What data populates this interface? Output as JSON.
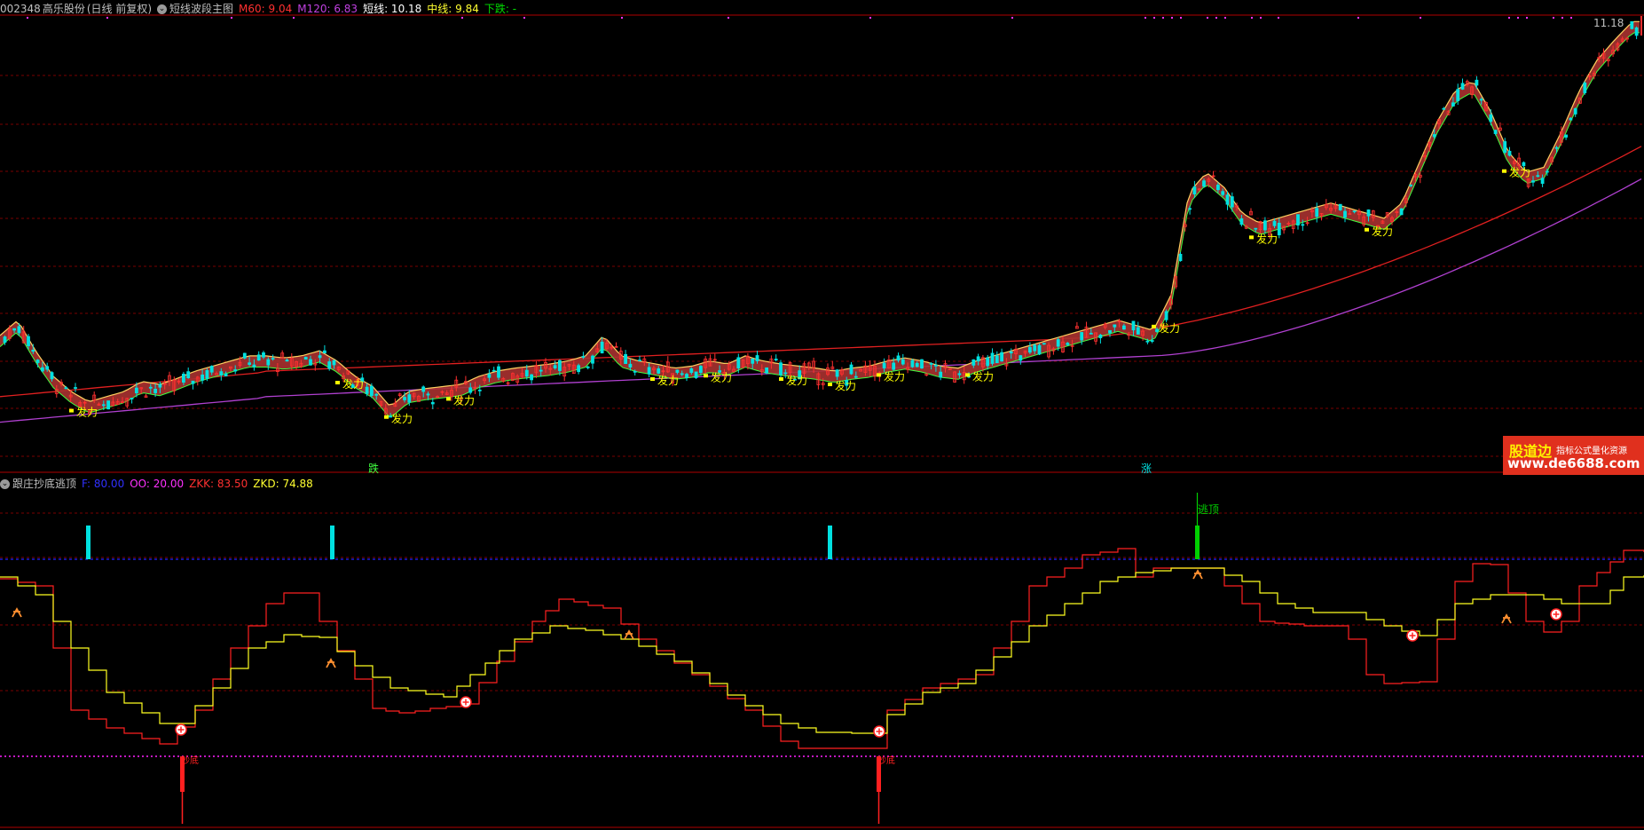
{
  "main_panel": {
    "stock_code": "002348",
    "stock_name": "高乐股份",
    "period": "(日线 前复权)",
    "indicator_name": "短线波段主图",
    "m60_label": "M60: 9.04",
    "m120_label": "M120: 6.83",
    "short_label": "短线: 10.18",
    "mid_label": "中线: 9.84",
    "down_label": "下跌: -",
    "price_max_label": "11.18",
    "signal_label": "发力",
    "bottom_markers": [
      "跌",
      "涨"
    ],
    "colors": {
      "up": "#ff3030",
      "down": "#00e0e0",
      "m60": "#e02020",
      "m120": "#b040d0",
      "band": "#a83230",
      "line_short": "#ffd060",
      "line_mid": "#ffffff",
      "signal": "#ffff00",
      "grid": "#7a0000"
    }
  },
  "sub_panel": {
    "title": "跟庄抄底逃顶",
    "f_label": "F: 80.00",
    "oo_label": "OO: 20.00",
    "zkk_label": "ZKK: 83.50",
    "zkd_label": "ZKD: 74.88",
    "top_escape_label": "逃顶",
    "bottom_label": "抄底",
    "colors": {
      "zkk": "#ff2020",
      "zkd": "#ffff20",
      "f": "#2020ff",
      "oo": "#ff20ff",
      "cyan": "#00e0e0",
      "green": "#00d000"
    }
  },
  "watermark": {
    "brand": "股道边",
    "tagline": "指标公式量化资源",
    "url": "www.de6688.com"
  },
  "chart_data": [
    {
      "type": "candlestick",
      "title": "短线波段主图",
      "series": [
        {
          "name": "M60",
          "values": [
            8.0,
            8.05,
            8.1,
            8.12,
            8.15,
            8.18,
            8.2,
            8.25,
            8.3,
            8.4,
            8.6,
            8.85,
            9.04
          ]
        },
        {
          "name": "M120",
          "values": [
            7.6,
            7.65,
            7.7,
            7.75,
            7.8,
            7.85,
            7.9,
            7.95,
            8.05,
            8.2,
            8.5,
            8.7,
            6.83
          ]
        },
        {
          "name": "短线",
          "values": [
            7.6,
            7.8,
            7.7,
            7.9,
            7.85,
            7.95,
            7.9,
            8.2,
            9.7,
            9.7,
            10.5,
            9.2,
            10.18
          ]
        },
        {
          "name": "中线",
          "values": [
            7.6,
            7.75,
            7.68,
            7.85,
            7.82,
            7.9,
            7.88,
            8.1,
            9.5,
            9.6,
            10.3,
            9.3,
            9.84
          ]
        }
      ],
      "ylim": [
        7.0,
        11.18
      ]
    },
    {
      "type": "line",
      "title": "跟庄抄底逃顶",
      "series": [
        {
          "name": "ZKK",
          "values": [
            80,
            40,
            20,
            15,
            45,
            65,
            40,
            25,
            55,
            68,
            52,
            38,
            15,
            10,
            40,
            70,
            88,
            85,
            60,
            58,
            40,
            72,
            52,
            83.5
          ]
        },
        {
          "name": "ZKD",
          "values": [
            75,
            55,
            35,
            25,
            40,
            50,
            48,
            30,
            45,
            58,
            55,
            45,
            30,
            18,
            30,
            55,
            75,
            80,
            68,
            62,
            55,
            62,
            58,
            74.88
          ]
        },
        {
          "name": "F",
          "values": [
            80
          ]
        },
        {
          "name": "OO",
          "values": [
            20
          ]
        }
      ],
      "ylim": [
        0,
        100
      ]
    }
  ]
}
